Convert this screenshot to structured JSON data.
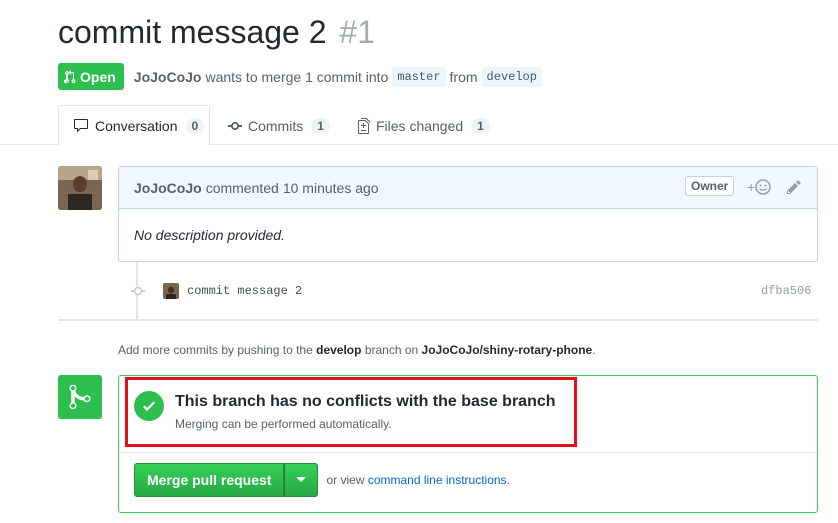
{
  "pr": {
    "title": "commit message 2",
    "number": "#1",
    "state": "Open",
    "author": "JoJoCoJo",
    "merge_text": "wants to merge 1 commit into",
    "base_branch": "master",
    "from_text": "from",
    "head_branch": "develop"
  },
  "tabs": [
    {
      "label": "Conversation",
      "count": "0",
      "icon": "comment-icon"
    },
    {
      "label": "Commits",
      "count": "1",
      "icon": "commit-icon"
    },
    {
      "label": "Files changed",
      "count": "1",
      "icon": "file-diff-icon"
    }
  ],
  "comment": {
    "author": "JoJoCoJo",
    "action": "commented",
    "time": "10 minutes ago",
    "badge": "Owner",
    "reaction_plus": "+",
    "body": "No description provided."
  },
  "commit": {
    "message": "commit message 2",
    "sha": "dfba506"
  },
  "hint": {
    "prefix": "Add more commits by pushing to the",
    "branch": "develop",
    "middle": "branch on",
    "repo": "JoJoCoJo/shiny-rotary-phone",
    "suffix": "."
  },
  "merge": {
    "status_title": "This branch has no conflicts with the base branch",
    "status_sub": "Merging can be performed automatically.",
    "button": "Merge pull request",
    "alt_prefix": "or view",
    "alt_link": "command line instructions",
    "alt_suffix": "."
  },
  "colors": {
    "green": "#2cbe4e",
    "highlight": "#e0101c",
    "link": "#0366d6"
  }
}
